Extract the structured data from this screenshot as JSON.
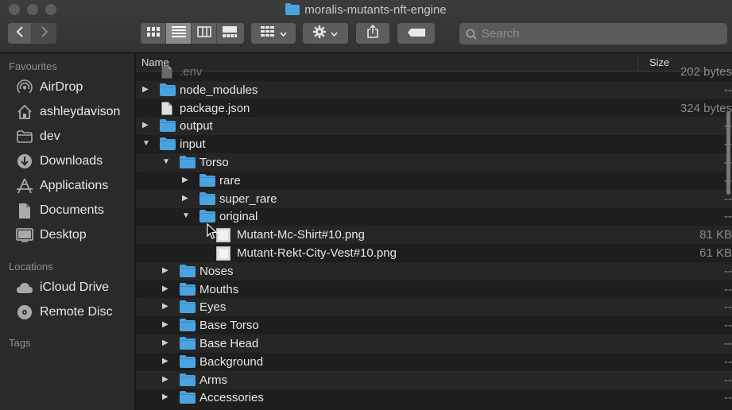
{
  "window": {
    "title": "moralis-mutants-nft-engine"
  },
  "toolbar": {
    "view_modes": [
      "icon-view-icon",
      "list-view-icon",
      "column-view-icon",
      "gallery-view-icon"
    ],
    "search_placeholder": "Search"
  },
  "sidebar": {
    "favourites_heading": "Favourites",
    "favourites": [
      {
        "label": "AirDrop",
        "icon": "airdrop-icon"
      },
      {
        "label": "ashleydavison",
        "icon": "home-icon"
      },
      {
        "label": "dev",
        "icon": "folder-icon"
      },
      {
        "label": "Downloads",
        "icon": "downloads-icon"
      },
      {
        "label": "Applications",
        "icon": "applications-icon"
      },
      {
        "label": "Documents",
        "icon": "documents-icon"
      },
      {
        "label": "Desktop",
        "icon": "desktop-icon"
      }
    ],
    "locations_heading": "Locations",
    "locations": [
      {
        "label": "iCloud Drive",
        "icon": "icloud-icon"
      },
      {
        "label": "Remote Disc",
        "icon": "disc-icon"
      }
    ],
    "tags_heading": "Tags"
  },
  "list": {
    "columns": {
      "name": "Name",
      "size": "Size"
    },
    "rows": [
      {
        "name": ".env",
        "size": "202 bytes",
        "kind": "file",
        "level": 0,
        "expand": "none",
        "dim": true
      },
      {
        "name": "node_modules",
        "size": "--",
        "kind": "folder",
        "level": 0,
        "expand": "collapsed"
      },
      {
        "name": "package.json",
        "size": "324 bytes",
        "kind": "file",
        "level": 0,
        "expand": "none"
      },
      {
        "name": "output",
        "size": "--",
        "kind": "folder",
        "level": 0,
        "expand": "collapsed"
      },
      {
        "name": "input",
        "size": "--",
        "kind": "folder",
        "level": 0,
        "expand": "expanded"
      },
      {
        "name": "Torso",
        "size": "--",
        "kind": "folder",
        "level": 1,
        "expand": "expanded"
      },
      {
        "name": "rare",
        "size": "--",
        "kind": "folder",
        "level": 2,
        "expand": "collapsed"
      },
      {
        "name": "super_rare",
        "size": "--",
        "kind": "folder",
        "level": 2,
        "expand": "collapsed"
      },
      {
        "name": "original",
        "size": "--",
        "kind": "folder",
        "level": 2,
        "expand": "expanded"
      },
      {
        "name": "Mutant-Mc-Shirt#10.png",
        "size": "81 KB",
        "kind": "image",
        "level": 3,
        "expand": "none"
      },
      {
        "name": "Mutant-Rekt-City-Vest#10.png",
        "size": "61 KB",
        "kind": "image",
        "level": 3,
        "expand": "none"
      },
      {
        "name": "Noses",
        "size": "--",
        "kind": "folder",
        "level": 1,
        "expand": "collapsed"
      },
      {
        "name": "Mouths",
        "size": "--",
        "kind": "folder",
        "level": 1,
        "expand": "collapsed"
      },
      {
        "name": "Eyes",
        "size": "--",
        "kind": "folder",
        "level": 1,
        "expand": "collapsed"
      },
      {
        "name": "Base Torso",
        "size": "--",
        "kind": "folder",
        "level": 1,
        "expand": "collapsed"
      },
      {
        "name": "Base Head",
        "size": "--",
        "kind": "folder",
        "level": 1,
        "expand": "collapsed"
      },
      {
        "name": "Background",
        "size": "--",
        "kind": "folder",
        "level": 1,
        "expand": "collapsed"
      },
      {
        "name": "Arms",
        "size": "--",
        "kind": "folder",
        "level": 1,
        "expand": "collapsed"
      },
      {
        "name": "Accessories",
        "size": "--",
        "kind": "folder",
        "level": 1,
        "expand": "collapsed"
      }
    ]
  },
  "colors": {
    "folder_blue": "#4aa3df",
    "accent": "#5d5d5d"
  }
}
